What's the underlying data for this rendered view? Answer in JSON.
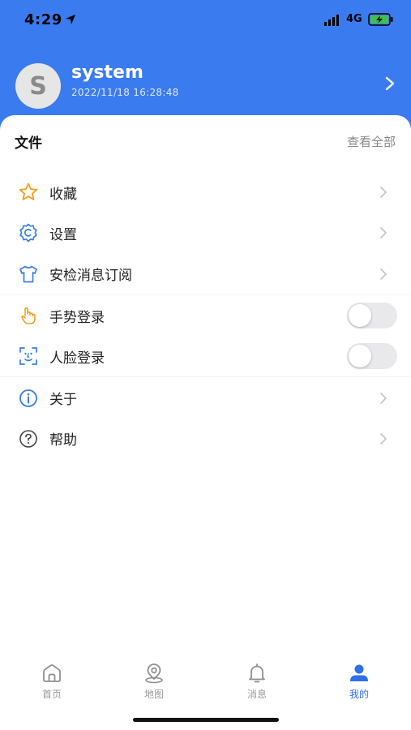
{
  "status_bar": {
    "time": "4:29",
    "network": "4G"
  },
  "profile": {
    "avatar_letter": "S",
    "username": "system",
    "login_time": "2022/11/18 16:28:48"
  },
  "files_section": {
    "title": "文件",
    "view_all": "查看全部"
  },
  "menu": {
    "items": [
      {
        "label": "收藏",
        "icon": "star-icon",
        "control": "chevron"
      },
      {
        "label": "设置",
        "icon": "gear-icon",
        "control": "chevron"
      },
      {
        "label": "安检消息订阅",
        "icon": "shirt-icon",
        "control": "chevron"
      },
      {
        "label": "手势登录",
        "icon": "hand-gesture-icon",
        "control": "toggle",
        "enabled": false
      },
      {
        "label": "人脸登录",
        "icon": "face-scan-icon",
        "control": "toggle",
        "enabled": false
      },
      {
        "label": "关于",
        "icon": "info-icon",
        "control": "chevron"
      },
      {
        "label": "帮助",
        "icon": "question-icon",
        "control": "chevron"
      }
    ]
  },
  "tabbar": {
    "tabs": [
      {
        "label": "首页",
        "icon": "home-icon",
        "active": false
      },
      {
        "label": "地图",
        "icon": "map-pin-icon",
        "active": false
      },
      {
        "label": "消息",
        "icon": "bell-icon",
        "active": false
      },
      {
        "label": "我的",
        "icon": "user-icon",
        "active": true
      }
    ]
  },
  "colors": {
    "header": "#3b7bf0",
    "accent": "#2f6fe8",
    "icon_orange": "#f0a020",
    "icon_blue": "#3a7ee0"
  }
}
